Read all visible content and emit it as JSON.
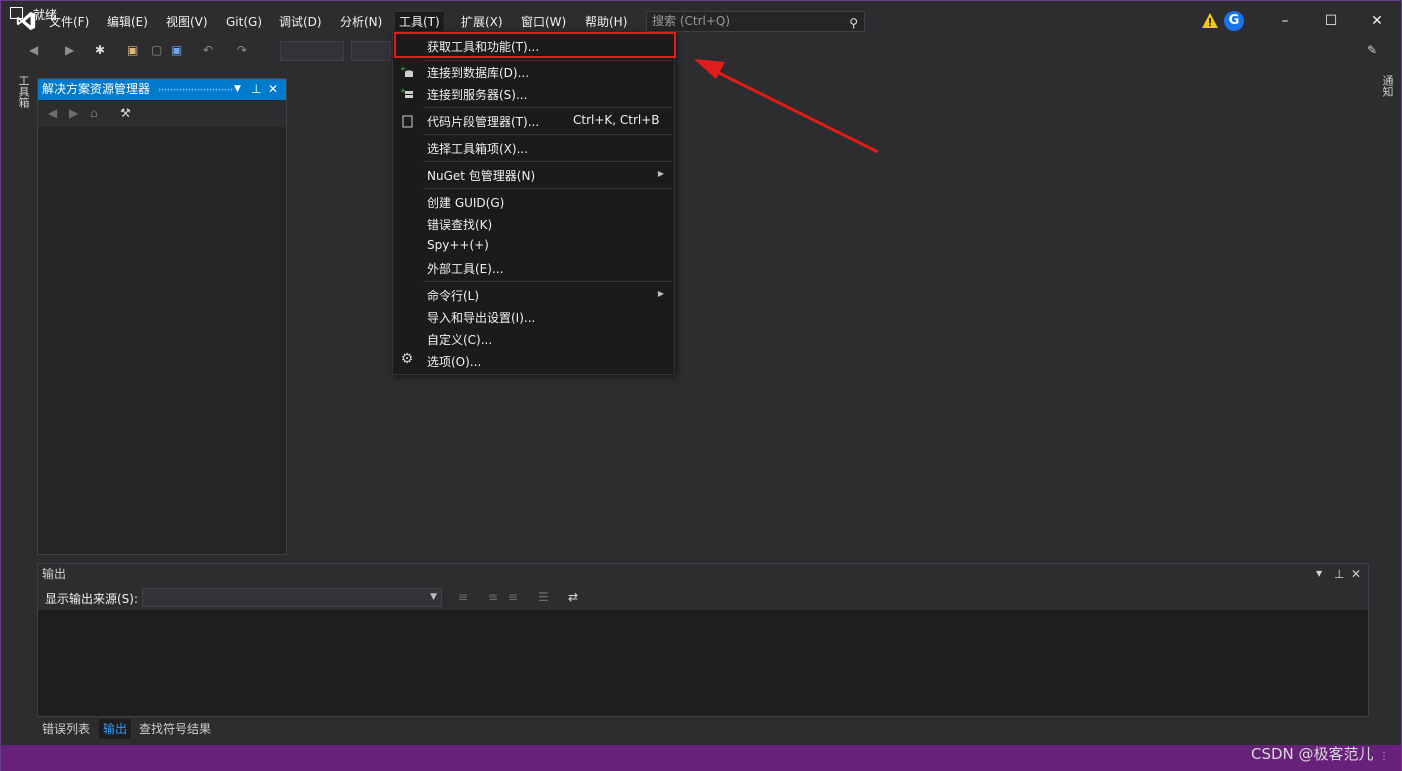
{
  "menubar": {
    "items": [
      "文件(F)",
      "编辑(E)",
      "视图(V)",
      "Git(G)",
      "调试(D)",
      "分析(N)",
      "工具(T)",
      "扩展(X)",
      "窗口(W)",
      "帮助(H)"
    ],
    "search_placeholder": "搜索 (Ctrl+Q)",
    "avatar_letter": "G"
  },
  "left_rail": {
    "label": "工具箱"
  },
  "right_rail": {
    "label": "通知"
  },
  "solution_explorer": {
    "title": "解决方案资源管理器"
  },
  "tools_menu": {
    "items": [
      {
        "label": "获取工具和功能(T)...",
        "shortcut": "",
        "submenu": false,
        "icon": ""
      },
      {
        "label": "连接到数据库(D)...",
        "shortcut": "",
        "submenu": false,
        "icon": "database-connect-icon"
      },
      {
        "label": "连接到服务器(S)...",
        "shortcut": "",
        "submenu": false,
        "icon": "server-connect-icon"
      },
      {
        "label": "代码片段管理器(T)...",
        "shortcut": "Ctrl+K, Ctrl+B",
        "submenu": false,
        "icon": "snippet-icon"
      },
      {
        "label": "选择工具箱项(X)...",
        "shortcut": "",
        "submenu": false,
        "icon": ""
      },
      {
        "label": "NuGet 包管理器(N)",
        "shortcut": "",
        "submenu": true,
        "icon": ""
      },
      {
        "label": "创建 GUID(G)",
        "shortcut": "",
        "submenu": false,
        "icon": ""
      },
      {
        "label": "错误查找(K)",
        "shortcut": "",
        "submenu": false,
        "icon": ""
      },
      {
        "label": "Spy++(+)",
        "shortcut": "",
        "submenu": false,
        "icon": ""
      },
      {
        "label": "外部工具(E)...",
        "shortcut": "",
        "submenu": false,
        "icon": ""
      },
      {
        "label": "命令行(L)",
        "shortcut": "",
        "submenu": true,
        "icon": ""
      },
      {
        "label": "导入和导出设置(I)...",
        "shortcut": "",
        "submenu": false,
        "icon": ""
      },
      {
        "label": "自定义(C)...",
        "shortcut": "",
        "submenu": false,
        "icon": ""
      },
      {
        "label": "选项(O)...",
        "shortcut": "",
        "submenu": false,
        "icon": "gear-icon"
      }
    ]
  },
  "output_panel": {
    "title": "输出",
    "source_label": "显示输出来源(S):",
    "source_value": ""
  },
  "bottom_tabs": [
    {
      "label": "错误列表",
      "active": false
    },
    {
      "label": "输出",
      "active": true
    },
    {
      "label": "查找符号结果",
      "active": false
    }
  ],
  "statusbar": {
    "text": "就绪"
  },
  "watermark": "CSDN @极客范儿",
  "colors": {
    "accent": "#007acc",
    "statusbar": "#68217a",
    "highlight": "#e21b1b",
    "background": "#2d2d30"
  }
}
